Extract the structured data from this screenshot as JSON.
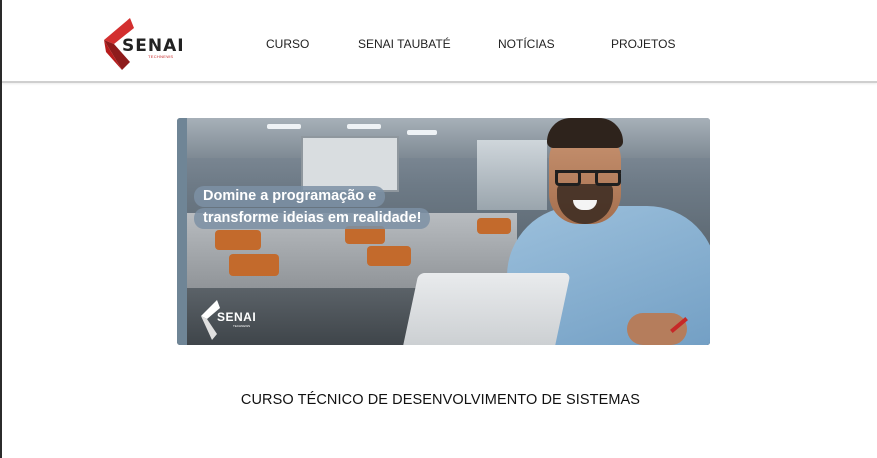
{
  "header": {
    "logo": {
      "word": "SENAI",
      "sub": "TECHNEWS",
      "icon": "senai-chevron-logo-icon",
      "colors": {
        "red": "#d32f2f",
        "dark_red": "#8e1b1b"
      }
    },
    "nav": [
      "CURSO",
      "SENAI TAUBATÉ",
      "NOTÍCIAS",
      "PROJETOS"
    ]
  },
  "banner": {
    "caption_line1": "Domine a programação e",
    "caption_line2": "transforme ideias em realidade!",
    "logo_word": "SENAI",
    "logo_sub": "TECHNEWS"
  },
  "course_title": "CURSO TÉCNICO DE DESENVOLVIMENTO DE SISTEMAS"
}
